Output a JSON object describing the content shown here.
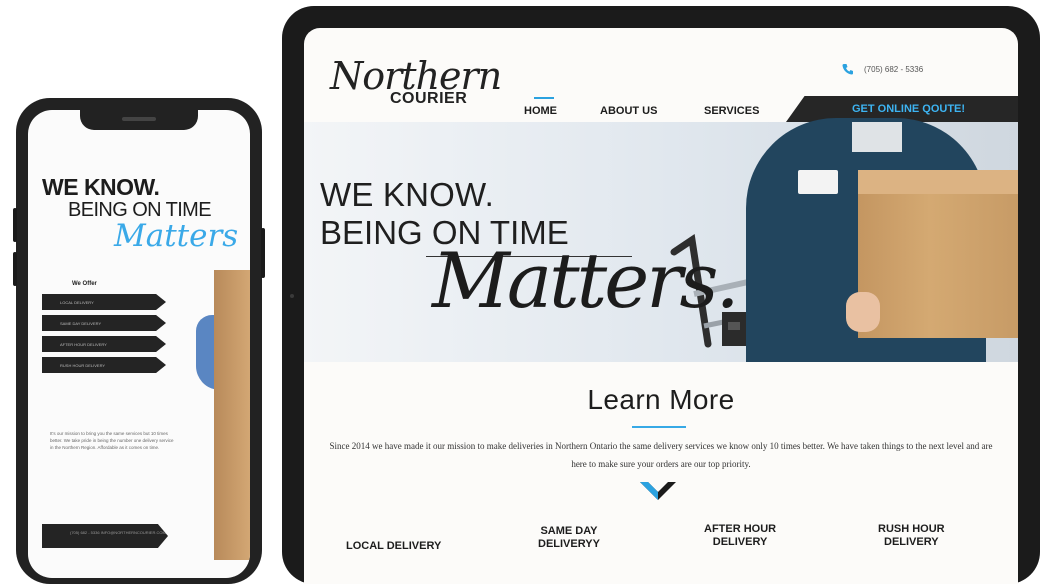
{
  "phone": {
    "headline_1": "WE KNOW.",
    "headline_2": "BEING ON TIME",
    "headline_script": "Matters",
    "offer_label": "We Offer",
    "offer_items": [
      "LOCAL DELIVERY",
      "SAME DAY DELIVERY",
      "AFTER HOUR DELIVERY",
      "RUSH HOUR DELIVERY"
    ],
    "paragraph": "It's our mission to bring you the same services but 10 times better. We take pride in being the number one delivery service in the Northern Region. Affordable as it comes on time.",
    "call_button": "(705) 682 - 5336 INFO@NORTHERNCOURIER.COM"
  },
  "tablet": {
    "logo_script": "Northern",
    "logo_sub": "COURIER",
    "phone_number": "(705) 682 - 5336",
    "nav": {
      "home": "HOME",
      "about": "ABOUT US",
      "services": "SERVICES",
      "quote": "GET ONLINE QOUTE!"
    },
    "hero": {
      "line1": "WE KNOW.",
      "line2": "BEING ON TIME",
      "script": "Matters."
    },
    "learn": {
      "title": "Learn More",
      "paragraph": "Since 2014 we have made it our mission to make deliveries in Northern Ontario the same delivery services we know only 10 times better. We have taken things to the next level and are here to make sure your orders are our top priority."
    },
    "services": {
      "local": "LOCAL DELIVERY",
      "same_day_1": "SAME DAY",
      "same_day_2": "DELIVERYY",
      "after_1": "AFTER HOUR",
      "after_2": "DELIVERY",
      "rush_1": "RUSH HOUR",
      "rush_2": "DELIVERY"
    }
  },
  "colors": {
    "accent_blue": "#2ba2e0",
    "dark": "#262626"
  }
}
